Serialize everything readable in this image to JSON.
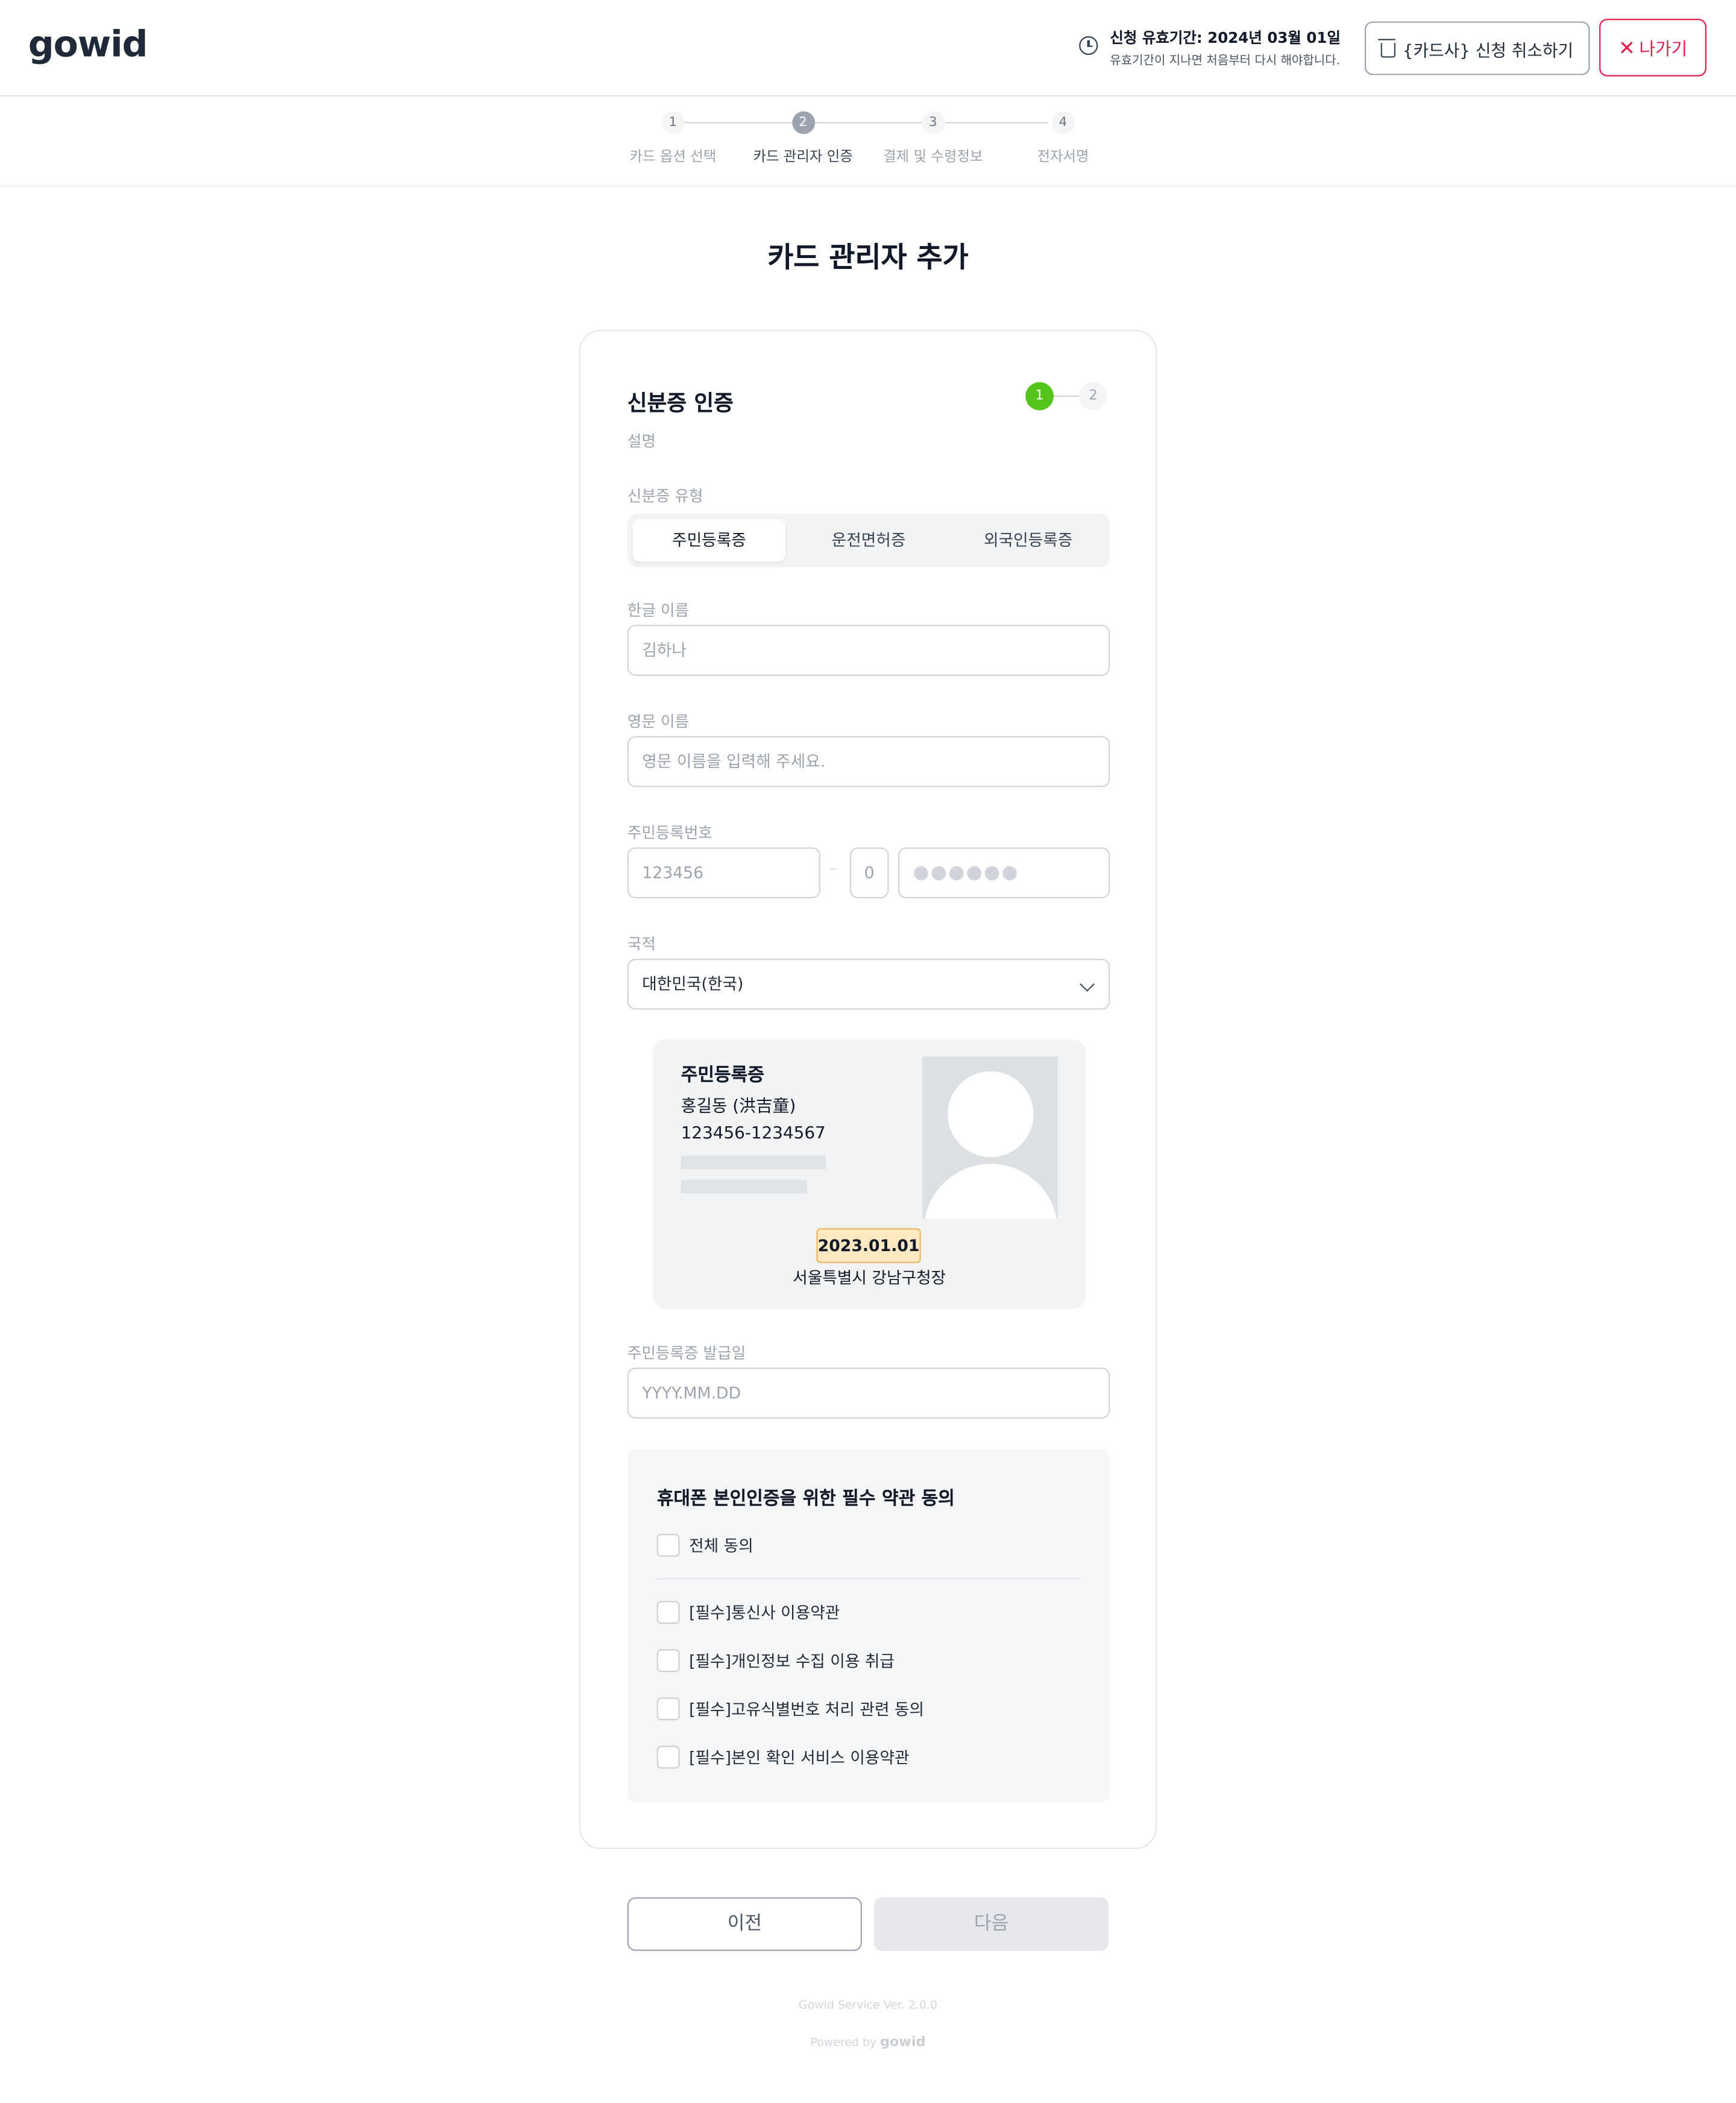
{
  "brand": {
    "logo_text": "gowid"
  },
  "header": {
    "expiry_title": "신청 유효기간: 2024년 03월 01일",
    "expiry_sub": "유효기간이 지나면 처음부터 다시 해야합니다.",
    "cancel_label": "{카드사} 신청 취소하기",
    "exit_label": "나가기",
    "icons": {
      "clock": "clock-icon",
      "trash": "trash-icon",
      "close": "close-icon"
    }
  },
  "stepper": {
    "steps": [
      {
        "num": "1",
        "label": "카드 옵션 선택"
      },
      {
        "num": "2",
        "label": "카드 관리자 인증"
      },
      {
        "num": "3",
        "label": "결제 및 수령정보"
      },
      {
        "num": "4",
        "label": "전자서명"
      }
    ],
    "active_index": 1
  },
  "page_title": "카드 관리자 추가",
  "form": {
    "section_title": "신분증 인증",
    "mini_steps": [
      "1",
      "2"
    ],
    "description": "설명",
    "id_type_label": "신분증 유형",
    "id_types": [
      "주민등록증",
      "운전면허증",
      "외국인등록증"
    ],
    "id_type_selected": "주민등록증",
    "korean_name_label": "한글 이름",
    "korean_name_placeholder": "김하나",
    "english_name_label": "영문 이름",
    "english_name_placeholder": "영문 이름을 입력해 주세요.",
    "rrn_label": "주민등록번호",
    "rrn_front_placeholder": "123456",
    "rrn_dash": "–",
    "rrn_gender_placeholder": "0",
    "rrn_back_mask": "●●●●●●",
    "nationality_label": "국적",
    "nationality_value": "대한민국(한국)",
    "id_card_sample": {
      "title": "주민등록증",
      "name": "홍길동 (洪吉童)",
      "number": "123456-1234567",
      "issue_date": "2023.01.01",
      "issuer": "서울특별시 강남구청장"
    },
    "issue_date_label": "주민등록증 발급일",
    "issue_date_placeholder": "YYYY.MM.DD"
  },
  "agreement": {
    "title": "휴대폰 본인인증을 위한 필수 약관 동의",
    "all_label": "전체 동의",
    "items": [
      "[필수]통신사 이용약관",
      "[필수]개인정보 수집 이용 취급",
      "[필수]고유식별번호 처리 관련 동의",
      "[필수]본인 확인 서비스 이용약관"
    ]
  },
  "buttons": {
    "prev": "이전",
    "next": "다음"
  },
  "footer": {
    "version_text": "Gowid Service Ver. 2.0.0",
    "powered_by": "Powered by",
    "powered_logo": "gowid"
  },
  "colors": {
    "accent_red": "#e11d48",
    "step_green": "#52c41a",
    "highlight": "#ffe8c2"
  }
}
